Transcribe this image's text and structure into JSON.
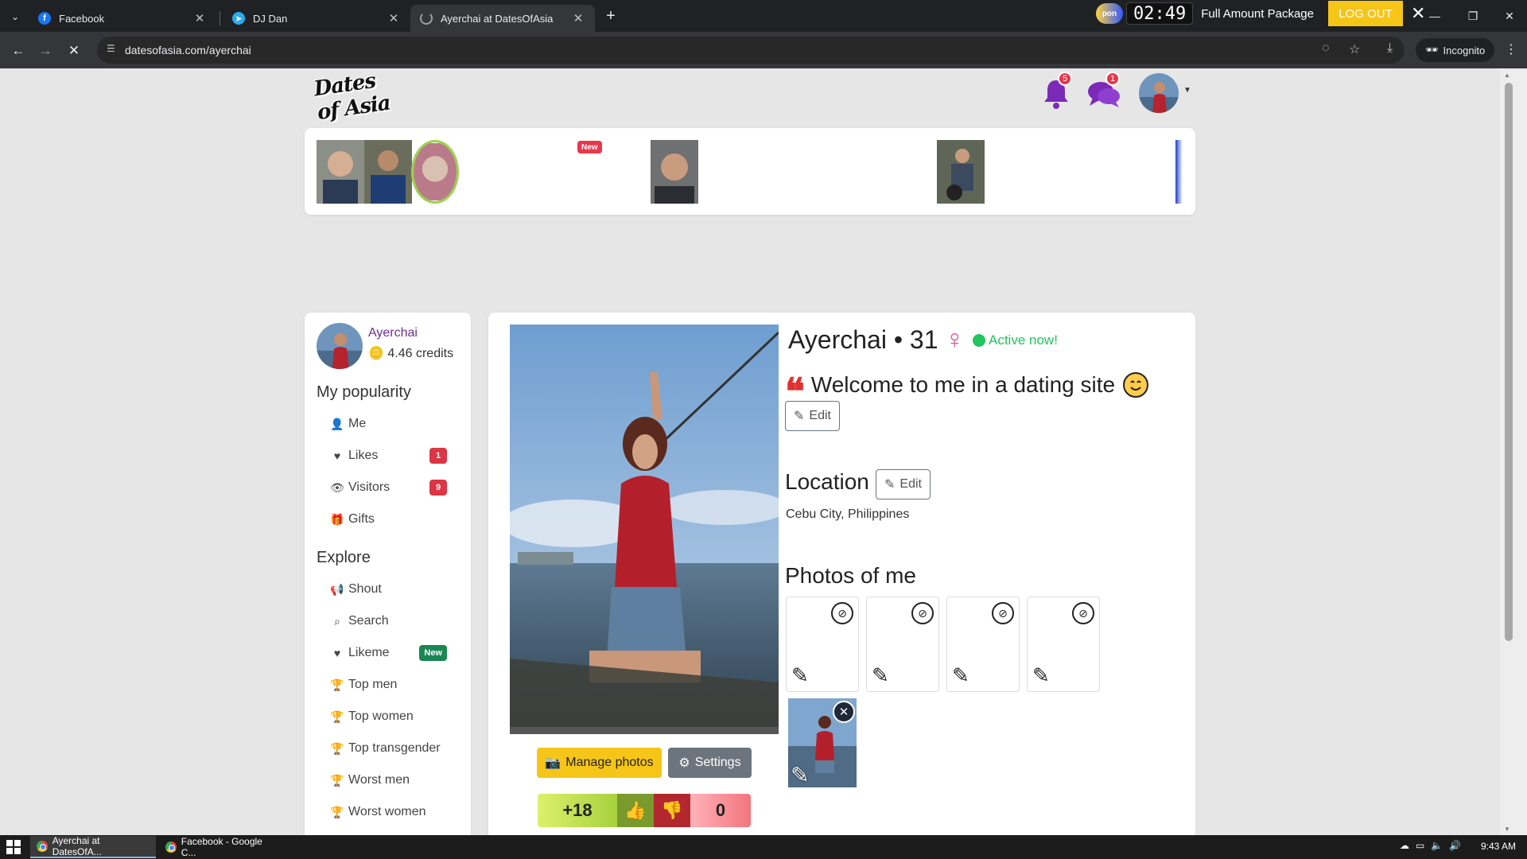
{
  "browser": {
    "tabs": [
      {
        "title": "Facebook",
        "icon": "facebook-icon"
      },
      {
        "title": "DJ Dan",
        "icon": "telegram-icon"
      },
      {
        "title": "Ayerchai at DatesOfAsia",
        "icon": "loading-icon",
        "active": true
      }
    ],
    "url": "datesofasia.com/ayerchai",
    "incognito_label": "Incognito"
  },
  "extension": {
    "logo_text": "pon",
    "timer": "02:49",
    "package": "Full Amount Package",
    "logout_label": "LOG OUT"
  },
  "site": {
    "logo_text": "Dates of Asia",
    "notifications_count": "5",
    "messages_count": "1",
    "new_badge": "New"
  },
  "sidebar": {
    "username": "Ayerchai",
    "credits": "4.46 credits",
    "popularity_heading": "My popularity",
    "popularity_items": [
      {
        "label": "Me",
        "icon": "user-icon"
      },
      {
        "label": "Likes",
        "icon": "heart-icon",
        "count": "1"
      },
      {
        "label": "Visitors",
        "icon": "eye-icon",
        "count": "9"
      },
      {
        "label": "Gifts",
        "icon": "gift-icon"
      }
    ],
    "explore_heading": "Explore",
    "explore_items": [
      {
        "label": "Shout",
        "icon": "megaphone-icon"
      },
      {
        "label": "Search",
        "icon": "search-icon"
      },
      {
        "label": "Likeme",
        "icon": "heart-icon",
        "badge": "New"
      },
      {
        "label": "Top men",
        "icon": "trophy-icon"
      },
      {
        "label": "Top women",
        "icon": "trophy-icon"
      },
      {
        "label": "Top transgender",
        "icon": "trophy-icon"
      },
      {
        "label": "Worst men",
        "icon": "trophy-icon"
      },
      {
        "label": "Worst women",
        "icon": "trophy-icon"
      }
    ]
  },
  "profile": {
    "title": "Ayerchai • 31",
    "active_status": "Active now!",
    "welcome": "Welcome to me in a dating site",
    "edit_label": "Edit",
    "location_heading": "Location",
    "location_value": "Cebu City, Philippines",
    "photos_heading": "Photos of me",
    "manage_photos_label": "Manage photos",
    "settings_label": "Settings",
    "votes_up": "+18",
    "votes_down": "0"
  },
  "taskbar": {
    "items": [
      "Ayerchai at DatesOfA...",
      "Facebook - Google C..."
    ],
    "time": "9:43 AM"
  },
  "colors": {
    "accent_yellow": "#f5c518",
    "active_green": "#22c55e",
    "badge_red": "#dc3545",
    "username_purple": "#6f2d91"
  }
}
